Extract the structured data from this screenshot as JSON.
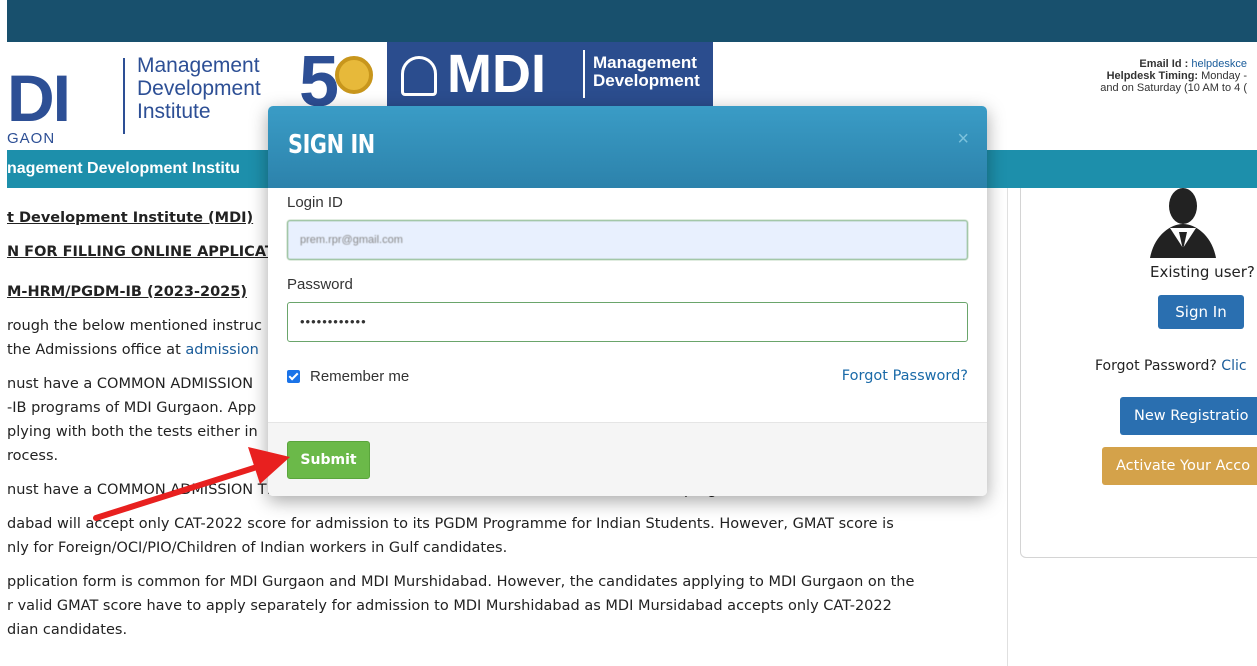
{
  "header": {
    "logo_di": "DI",
    "logo_gaon": "GAON",
    "logo_text": [
      "Management",
      "Development",
      "Institute"
    ],
    "fifty": "5",
    "mdi_word": "MDI",
    "mdi_sub": [
      "Management",
      "Development"
    ],
    "contact": {
      "email_label": "Email Id : ",
      "email_value": "helpdeskce",
      "timing_label": "Helpdesk Timing:",
      "timing_value": " Monday -",
      "saturday": "and on Saturday (10 AM to 4 ("
    }
  },
  "nav": {
    "title": "nagement Development Institu"
  },
  "content": {
    "lines": [
      "t Development Institute (MDI)",
      "N FOR FILLING ONLINE APPLICATIO",
      "M-HRM/PGDM-IB (2023-2025)",
      "rough the below mentioned instruc",
      " the Admissions office at ",
      "nust have a COMMON ADMISSION",
      "-IB programs of MDI Gurgaon. App",
      "plying with both the tests either in",
      "rocess.",
      "nust have a COMMON ADMISSION TEST (CAT-2022) for admission to MDI Murshidabad PGDM programme.",
      "dabad will accept only CAT-2022 score for admission to its PGDM Programme for Indian Students. However, GMAT score is",
      "nly for Foreign/OCI/PIO/Children of Indian workers in Gulf candidates.",
      "pplication form is common for MDI Gurgaon and MDI Murshidabad. However, the candidates applying to MDI Gurgaon on the",
      "r valid GMAT score have to apply separately for admission to MDI Murshidabad as MDI Mursidabad accepts only CAT-2022",
      "dian candidates."
    ],
    "admission_link": "admission"
  },
  "side": {
    "existing_user": "Existing user?",
    "signin": "Sign In",
    "forgot_label": "Forgot Password? ",
    "forgot_link": "Clic",
    "new_registration": "New Registratio",
    "activate": "Activate Your Acco"
  },
  "modal": {
    "title": "SIGN IN",
    "close": "×",
    "login_label": "Login ID",
    "login_value": "prem.rpr@gmail.com",
    "password_label": "Password",
    "password_value": "••••••••••••",
    "remember_label": "Remember me",
    "remember_checked": true,
    "forgot_password": "Forgot Password?",
    "submit": "Submit"
  },
  "colors": {
    "topbar": "#18506d",
    "nav": "#1d8fab",
    "modal_header": "#2c82ab",
    "submit": "#6bb949",
    "arrow": "#e8201f"
  }
}
